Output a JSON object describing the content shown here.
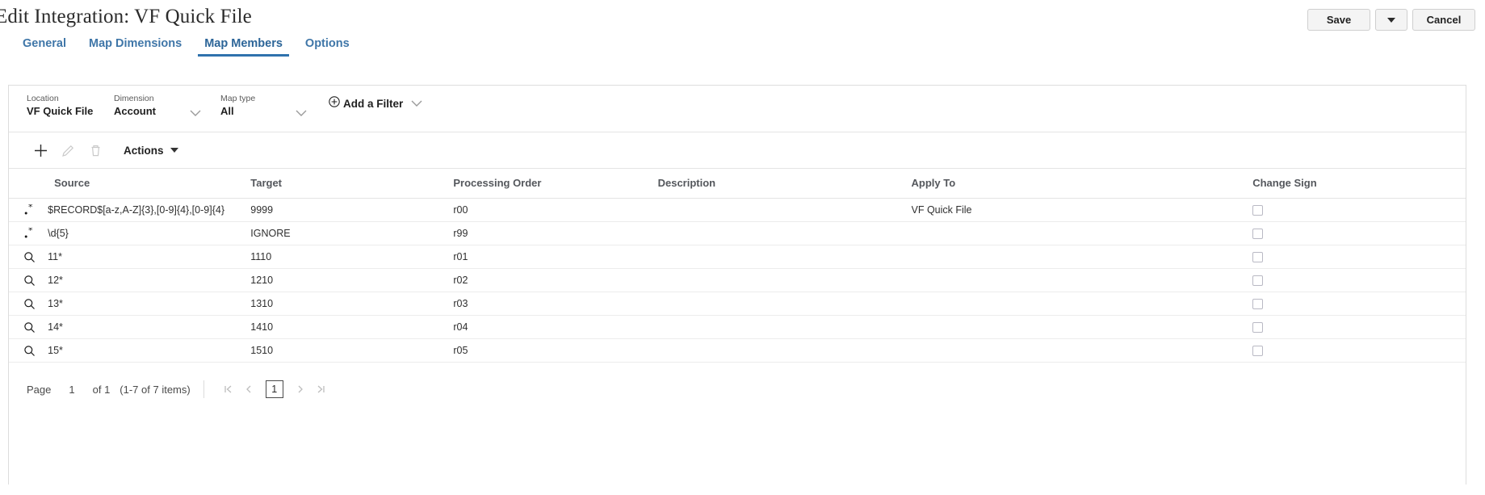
{
  "header": {
    "title": "Edit Integration: VF Quick File",
    "save_label": "Save",
    "split_icon": "caret-down-icon",
    "cancel_label": "Cancel"
  },
  "tabs": [
    {
      "label": "General",
      "active": false
    },
    {
      "label": "Map Dimensions",
      "active": false
    },
    {
      "label": "Map Members",
      "active": true
    },
    {
      "label": "Options",
      "active": false
    }
  ],
  "filters": {
    "location": {
      "label": "Location",
      "value": "VF Quick File"
    },
    "dimension": {
      "label": "Dimension",
      "value": "Account"
    },
    "map_type": {
      "label": "Map type",
      "value": "All"
    },
    "add_filter_label": "Add a Filter"
  },
  "toolbar": {
    "add_icon": "plus-icon",
    "edit_icon": "pencil-icon",
    "delete_icon": "trash-icon",
    "actions_label": "Actions"
  },
  "table": {
    "columns": [
      "Source",
      "Target",
      "Processing Order",
      "Description",
      "Apply To",
      "Change Sign"
    ],
    "rows": [
      {
        "icon": "regex-icon",
        "source": "$RECORD$[a-z,A-Z]{3},[0-9]{4},[0-9]{4}",
        "target": "9999",
        "processing_order": "r00",
        "description": "",
        "apply_to": "VF Quick File",
        "change_sign": false
      },
      {
        "icon": "regex-icon",
        "source": "\\d{5}",
        "target": "IGNORE",
        "processing_order": "r99",
        "description": "",
        "apply_to": "",
        "change_sign": false
      },
      {
        "icon": "search-icon",
        "source": "11*",
        "target": "1110",
        "processing_order": "r01",
        "description": "",
        "apply_to": "",
        "change_sign": false
      },
      {
        "icon": "search-icon",
        "source": "12*",
        "target": "1210",
        "processing_order": "r02",
        "description": "",
        "apply_to": "",
        "change_sign": false
      },
      {
        "icon": "search-icon",
        "source": "13*",
        "target": "1310",
        "processing_order": "r03",
        "description": "",
        "apply_to": "",
        "change_sign": false
      },
      {
        "icon": "search-icon",
        "source": "14*",
        "target": "1410",
        "processing_order": "r04",
        "description": "",
        "apply_to": "",
        "change_sign": false
      },
      {
        "icon": "search-icon",
        "source": "15*",
        "target": "1510",
        "processing_order": "r05",
        "description": "",
        "apply_to": "",
        "change_sign": false
      }
    ]
  },
  "pager": {
    "page_label": "Page",
    "page_number": "1",
    "of_label": "of 1",
    "items_label": "(1-7 of 7 items)",
    "first_icon": "page-first-icon",
    "prev_icon": "page-prev-icon",
    "current_page": "1",
    "next_icon": "page-next-icon",
    "last_icon": "page-last-icon"
  },
  "colors": {
    "tab_link": "#3f76a8",
    "tab_active": "#2c6598",
    "tab_underline": "#2f72ad",
    "border": "#dddddd",
    "row_divider": "#ececec",
    "checkbox_border": "#b9b9c4"
  }
}
